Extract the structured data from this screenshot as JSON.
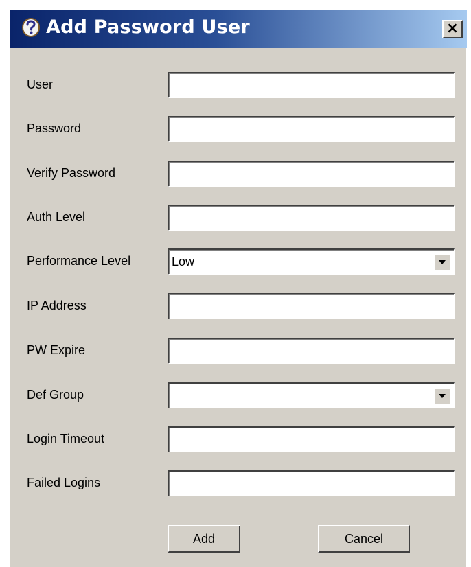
{
  "dialog": {
    "title": "Add Password User",
    "close_label": "×",
    "title_icon": "help-question-icon",
    "colors": {
      "titlebar_start": "#0a246a",
      "titlebar_end": "#a6caf0",
      "background": "#d4d0c8"
    }
  },
  "form": {
    "fields": [
      {
        "label": "User",
        "value": "",
        "type": "text"
      },
      {
        "label": "Password",
        "value": "",
        "type": "password"
      },
      {
        "label": "Verify Password",
        "value": "",
        "type": "password"
      },
      {
        "label": "Auth Level",
        "value": "",
        "type": "text"
      },
      {
        "label": "Performance Level",
        "value": "Low",
        "type": "select"
      },
      {
        "label": "IP Address",
        "value": "",
        "type": "text"
      },
      {
        "label": "PW Expire",
        "value": "",
        "type": "text"
      },
      {
        "label": "Def Group",
        "value": "",
        "type": "select"
      },
      {
        "label": "Login Timeout",
        "value": "",
        "type": "text"
      },
      {
        "label": "Failed Logins",
        "value": "",
        "type": "text"
      }
    ]
  },
  "buttons": {
    "add_label": "Add",
    "cancel_label": "Cancel"
  }
}
